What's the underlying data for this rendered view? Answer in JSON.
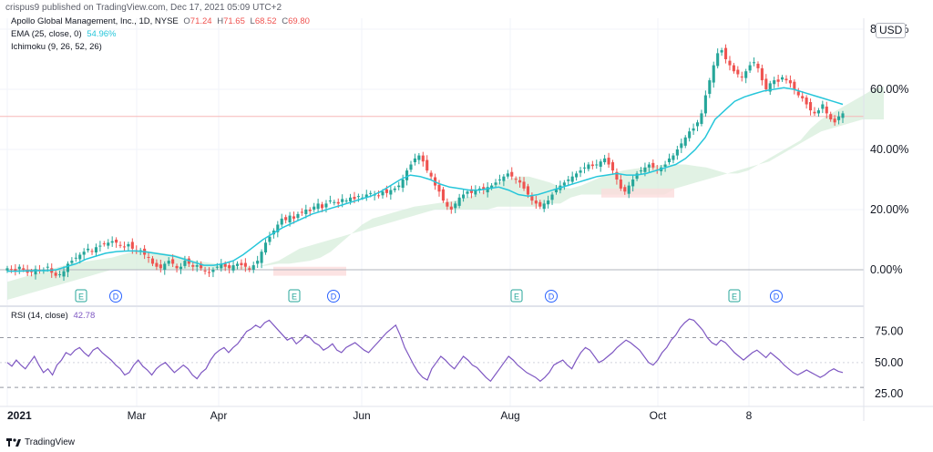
{
  "header": {
    "publisher_line": "crispus9 published on TradingView.com, Dec 17, 2021 05:09 UTC+2"
  },
  "legend": {
    "symbol": "Apollo Global Management, Inc., 1D, NYSE",
    "ohlc": {
      "O": "71.24",
      "H": "71.65",
      "L": "68.52",
      "C": "69.80"
    },
    "ema_label": "EMA (25, close, 0)",
    "ema_value": "54.96%",
    "ichimoku_label": "Ichimoku (9, 26, 52, 26)",
    "rsi_label": "RSI (14, close)",
    "rsi_value": "42.78"
  },
  "currency": "USD",
  "footer": {
    "brand": "TradingView"
  },
  "colors": {
    "ema": "#26c6da",
    "rsi": "#7e57c2",
    "up": "#26a69a",
    "down": "#ef5350",
    "cloud_green": "#d7eedb",
    "cloud_red": "#fbdcdc",
    "grid": "#f0f3fa",
    "axis": "#131722"
  },
  "chart_data": [
    {
      "type": "candlestick",
      "unit": "% change",
      "ylim": [
        -4,
        82
      ],
      "y_ticks": [
        "80.00%",
        "60.00%",
        "40.00%",
        "20.00%",
        "0.00%"
      ],
      "y_tick_values": [
        80,
        60,
        40,
        20,
        0
      ],
      "horizontal_line": 51,
      "x_tick_labels": [
        "2021",
        "Mar",
        "Apr",
        "Jun",
        "Aug",
        "Oct",
        "8"
      ],
      "x_tick_positions": [
        8,
        150,
        240,
        397,
        560,
        722,
        822
      ],
      "events": [
        {
          "label": "E",
          "x": 89
        },
        {
          "label": "D",
          "x": 127
        },
        {
          "label": "E",
          "x": 323
        },
        {
          "label": "D",
          "x": 366
        },
        {
          "label": "E",
          "x": 567
        },
        {
          "label": "D",
          "x": 605
        },
        {
          "label": "E",
          "x": 806
        },
        {
          "label": "D",
          "x": 852
        }
      ],
      "series": [
        {
          "name": "price",
          "x_start": 8,
          "x_end": 925,
          "values": [
            0.5,
            0,
            -0.5,
            1,
            0,
            -1,
            -0.8,
            0.2,
            -0.5,
            0,
            1,
            -1,
            -2,
            -1.5,
            -0.5,
            2,
            3,
            4,
            5,
            6,
            7,
            6,
            7.5,
            8,
            8.5,
            9,
            9.5,
            9,
            8,
            7.5,
            8.5,
            7,
            6,
            6.5,
            5,
            4,
            2,
            1,
            0.5,
            2,
            3,
            2,
            0.5,
            1,
            3,
            2,
            1,
            1.5,
            0.5,
            -0.5,
            -1,
            0,
            1,
            2,
            1,
            0.5,
            1.5,
            2,
            1.5,
            1,
            0,
            1.5,
            3,
            6,
            9,
            11,
            13,
            15,
            17,
            16.5,
            18,
            17,
            18.5,
            19,
            20,
            19.5,
            21,
            22,
            20.5,
            22,
            23,
            22.5,
            22,
            23.5,
            23,
            24,
            23.5,
            24.5,
            24,
            25,
            25.5,
            25,
            24.5,
            26,
            25.5,
            26.5,
            27,
            28,
            30,
            33,
            35,
            37,
            38,
            36,
            33,
            31,
            28,
            26,
            23,
            21,
            20,
            22,
            24,
            25,
            26,
            25.5,
            26.5,
            27,
            26.5,
            27.5,
            28,
            29,
            30,
            31,
            32,
            31,
            30,
            29,
            27,
            25,
            23,
            22,
            21,
            22,
            23,
            25,
            27,
            28,
            29,
            30,
            31,
            32,
            33,
            34,
            35,
            34.5,
            35,
            36,
            37,
            35,
            33,
            30,
            27,
            26,
            28,
            30,
            32,
            33,
            34,
            35,
            34,
            33,
            34,
            35,
            37,
            38,
            40,
            42,
            44,
            46,
            47,
            49,
            52,
            58,
            63,
            68,
            72,
            73,
            70,
            68,
            66,
            65,
            64,
            66,
            68,
            69,
            67,
            63,
            60,
            62,
            63,
            62.5,
            64,
            63,
            62,
            60,
            58,
            57,
            55,
            53,
            52,
            53,
            55,
            52,
            50,
            49,
            51,
            52
          ],
          "color": "#26a69a"
        },
        {
          "name": "EMA",
          "x_start": 8,
          "x_end": 925,
          "values": [
            -0.5,
            -0.5,
            -0.4,
            -0.3,
            -0.3,
            0,
            1,
            2,
            3.5,
            4.5,
            5.5,
            6,
            6.2,
            6.3,
            6,
            5.5,
            5,
            4.5,
            3.5,
            2.5,
            1.5,
            1.5,
            2,
            3,
            5,
            7.5,
            10,
            12,
            14,
            15.5,
            17,
            18.5,
            19.5,
            20.5,
            21.5,
            22.5,
            23.5,
            24.5,
            26,
            28,
            30,
            31.5,
            31,
            30,
            28.5,
            27.5,
            27,
            26.5,
            26.5,
            27,
            27.5,
            26.5,
            25,
            24.5,
            25,
            26,
            27,
            28,
            29,
            30,
            31,
            31.5,
            32,
            31.5,
            31.5,
            32,
            33,
            34,
            35,
            37,
            40,
            44,
            50,
            53,
            56,
            57.5,
            58.5,
            59.5,
            60,
            60.5,
            60,
            59,
            58,
            57,
            56,
            55
          ],
          "color": "#26c6da"
        },
        {
          "name": "cloud_upper",
          "x_start": 8,
          "x_end": 970,
          "values": [
            -4,
            -3,
            -2,
            -1,
            0,
            1,
            2,
            2.5,
            3,
            3.5,
            4,
            5,
            6,
            6.5,
            6,
            5.5,
            5,
            4,
            3,
            2.5,
            2,
            1.5,
            1,
            1,
            1,
            1.5,
            2,
            2,
            2.5,
            3,
            4,
            6,
            9,
            12,
            15,
            17,
            18,
            19,
            20,
            21,
            21.5,
            22,
            22.5,
            23,
            24,
            25,
            27,
            29,
            30,
            31,
            31,
            30,
            29,
            27.5,
            27,
            28,
            29.5,
            31,
            32,
            33,
            33.5,
            34,
            34.5,
            35,
            35,
            35,
            34.5,
            34,
            33,
            32,
            32,
            33,
            35,
            37,
            39,
            41,
            43,
            47,
            50,
            52,
            54,
            56,
            58,
            60,
            61
          ],
          "color": "#d7eedb"
        },
        {
          "name": "cloud_lower",
          "x_start": 8,
          "x_end": 970,
          "values": [
            -10,
            -9,
            -8,
            -7,
            -6,
            -5,
            -4,
            -3,
            -2,
            -1,
            0,
            0,
            0,
            0,
            0,
            0,
            0,
            0,
            0,
            0,
            0,
            0,
            0,
            0,
            1,
            2,
            3,
            5,
            7,
            8,
            9,
            10,
            11,
            12,
            13,
            14,
            15,
            16,
            17,
            18,
            19,
            20,
            20,
            20,
            20,
            20,
            20,
            21,
            21,
            21,
            21,
            21,
            22,
            22,
            24,
            25,
            25,
            25,
            25,
            25,
            25,
            25,
            25,
            25,
            27,
            28,
            29,
            30,
            31,
            32,
            33,
            34,
            35,
            36,
            38,
            40,
            42,
            44,
            46,
            47,
            48,
            49,
            50,
            50,
            50
          ],
          "color": "#d7eedb"
        }
      ]
    },
    {
      "type": "line",
      "name": "RSI",
      "ylim": [
        25,
        87
      ],
      "y_ticks": [
        "75.00",
        "50.00",
        "25.00"
      ],
      "y_tick_values": [
        75,
        50,
        25
      ],
      "bands": [
        70,
        30
      ],
      "series": [
        {
          "name": "RSI",
          "x_start": 8,
          "x_end": 925,
          "values": [
            50,
            47,
            52,
            48,
            45,
            50,
            55,
            48,
            42,
            45,
            40,
            48,
            52,
            58,
            56,
            60,
            62,
            58,
            55,
            60,
            62,
            58,
            55,
            52,
            48,
            45,
            40,
            42,
            48,
            52,
            47,
            44,
            40,
            45,
            48,
            50,
            46,
            42,
            45,
            48,
            45,
            40,
            37,
            42,
            45,
            52,
            57,
            60,
            62,
            58,
            62,
            65,
            70,
            75,
            77,
            80,
            78,
            82,
            84,
            80,
            76,
            72,
            68,
            70,
            65,
            68,
            72,
            70,
            66,
            64,
            60,
            62,
            65,
            60,
            58,
            62,
            64,
            66,
            63,
            60,
            58,
            62,
            66,
            70,
            74,
            77,
            80,
            72,
            62,
            55,
            48,
            42,
            38,
            36,
            45,
            50,
            55,
            52,
            48,
            45,
            50,
            55,
            52,
            48,
            46,
            42,
            38,
            35,
            40,
            45,
            50,
            55,
            52,
            48,
            45,
            42,
            40,
            38,
            35,
            38,
            42,
            48,
            50,
            52,
            48,
            45,
            52,
            58,
            62,
            60,
            55,
            50,
            52,
            55,
            58,
            62,
            65,
            68,
            66,
            63,
            60,
            55,
            50,
            48,
            52,
            58,
            62,
            68,
            72,
            78,
            82,
            85,
            84,
            80,
            76,
            70,
            66,
            64,
            68,
            66,
            62,
            58,
            55,
            52,
            55,
            58,
            60,
            57,
            54,
            58,
            55,
            52,
            48,
            45,
            42,
            40,
            42,
            44,
            42,
            40,
            38,
            40,
            43,
            45,
            43,
            42
          ]
        }
      ]
    }
  ]
}
